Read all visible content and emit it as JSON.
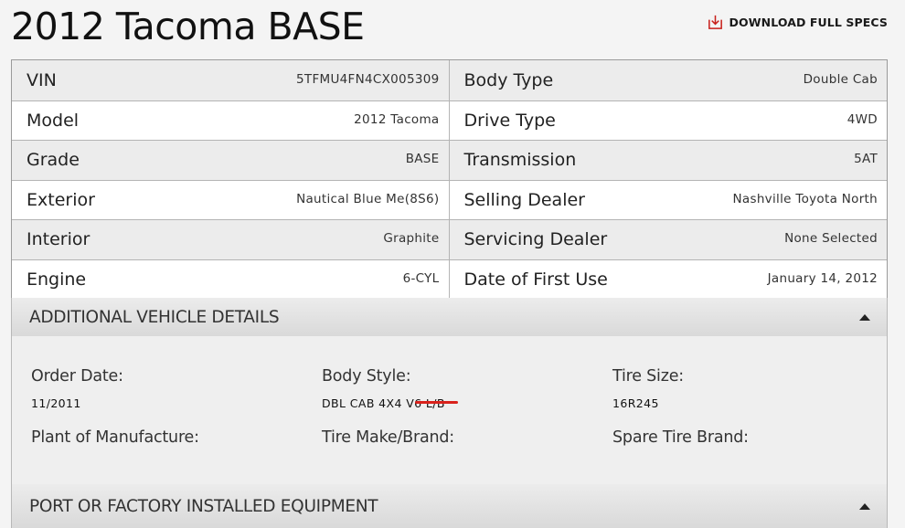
{
  "page": {
    "title": "2012 Tacoma BASE",
    "download_label": "DOWNLOAD FULL SPECS"
  },
  "specs": {
    "rows": [
      {
        "left": {
          "label": "VIN",
          "value": "5TFMU4FN4CX005309"
        },
        "right": {
          "label": "Body Type",
          "value": "Double Cab"
        }
      },
      {
        "left": {
          "label": "Model",
          "value": "2012 Tacoma"
        },
        "right": {
          "label": "Drive Type",
          "value": "4WD"
        }
      },
      {
        "left": {
          "label": "Grade",
          "value": "BASE"
        },
        "right": {
          "label": "Transmission",
          "value": "5AT"
        }
      },
      {
        "left": {
          "label": "Exterior",
          "value": "Nautical Blue Me(8S6)"
        },
        "right": {
          "label": "Selling Dealer",
          "value": "Nashville Toyota North"
        }
      },
      {
        "left": {
          "label": "Interior",
          "value": "Graphite"
        },
        "right": {
          "label": "Servicing Dealer",
          "value": "None Selected"
        }
      },
      {
        "left": {
          "label": "Engine",
          "value": "6-CYL"
        },
        "right": {
          "label": "Date of First Use",
          "value": "January 14, 2012"
        }
      }
    ]
  },
  "additional": {
    "title": "ADDITIONAL VEHICLE DETAILS",
    "items": [
      {
        "label": "Order Date:",
        "value": "11/2011"
      },
      {
        "label": "Body Style:",
        "value": "DBL CAB 4X4 V6 L/B"
      },
      {
        "label": "Tire Size:",
        "value": "16R245"
      },
      {
        "label": "Plant of Manufacture:",
        "value": ""
      },
      {
        "label": "Tire Make/Brand:",
        "value": ""
      },
      {
        "label": "Spare Tire Brand:",
        "value": ""
      }
    ]
  },
  "equipment": {
    "title": "PORT OR FACTORY INSTALLED EQUIPMENT"
  },
  "colors": {
    "accent": "#d9221c"
  },
  "icons": {
    "download": "download-icon",
    "collapse": "caret-up-icon"
  }
}
